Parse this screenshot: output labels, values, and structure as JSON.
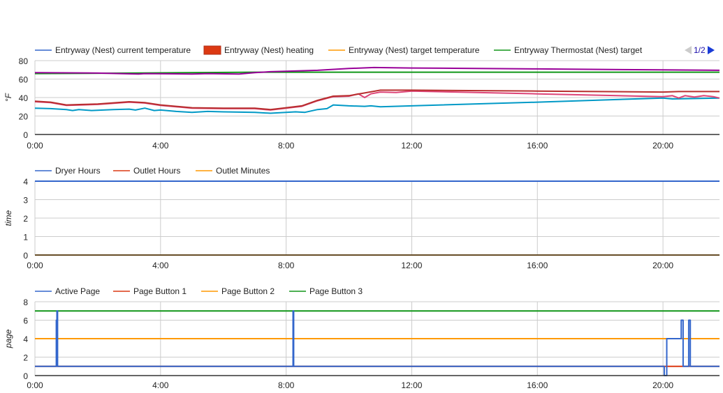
{
  "pager": {
    "label": "1/2"
  },
  "chart_data": [
    {
      "type": "line",
      "ylabel": "°F",
      "ylim": [
        0,
        80
      ],
      "yticks": [
        "0",
        "20",
        "40",
        "60",
        "80"
      ],
      "yvals": [
        0,
        20,
        40,
        60,
        80
      ],
      "xlim": [
        0,
        21.8
      ],
      "xticks": [
        "0:00",
        "4:00",
        "8:00",
        "12:00",
        "16:00",
        "20:00"
      ],
      "xvals": [
        0,
        4,
        8,
        12,
        16,
        20
      ],
      "legend": [
        {
          "label": "Entryway (Nest) current temperature",
          "color": "#3366cc",
          "kind": "line"
        },
        {
          "label": "Entryway (Nest) heating",
          "color": "#dc3912",
          "kind": "box"
        },
        {
          "label": "Entryway (Nest) target temperature",
          "color": "#ff9900",
          "kind": "line"
        },
        {
          "label": "Entryway Thermostat (Nest) target",
          "color": "#109618",
          "kind": "line"
        }
      ],
      "series": [
        {
          "name": "Entryway Thermostat (Nest) target",
          "color": "#109618",
          "points": [
            [
              0,
              66
            ],
            [
              3,
              66.5
            ],
            [
              7,
              67.5
            ],
            [
              21.8,
              67.5
            ]
          ]
        },
        {
          "name": "Entryway (Nest) current temperature",
          "color": "#990099",
          "points": [
            [
              0,
              67
            ],
            [
              2,
              66.5
            ],
            [
              3.3,
              65.5
            ],
            [
              3.5,
              66
            ],
            [
              5,
              65.5
            ],
            [
              5.5,
              66
            ],
            [
              6.5,
              65.5
            ],
            [
              7,
              67
            ],
            [
              7.5,
              68
            ],
            [
              8,
              68.5
            ],
            [
              9,
              69.5
            ],
            [
              10,
              71.5
            ],
            [
              10.8,
              72.5
            ],
            [
              12,
              72
            ],
            [
              16,
              71
            ],
            [
              20,
              70
            ],
            [
              21.8,
              69.5
            ]
          ]
        },
        {
          "name": "Entryway (Nest) current temperature",
          "color": "#0099c6",
          "points": [
            [
              0,
              28.5
            ],
            [
              0.5,
              28
            ],
            [
              1,
              27
            ],
            [
              1.2,
              26
            ],
            [
              1.4,
              27
            ],
            [
              1.8,
              26
            ],
            [
              2.5,
              27
            ],
            [
              3,
              27.5
            ],
            [
              3.2,
              26.5
            ],
            [
              3.5,
              28.5
            ],
            [
              3.8,
              26
            ],
            [
              4,
              26.5
            ],
            [
              4.5,
              25
            ],
            [
              5,
              24
            ],
            [
              5.5,
              25
            ],
            [
              6,
              24.5
            ],
            [
              7,
              24
            ],
            [
              7.5,
              23
            ],
            [
              8,
              24
            ],
            [
              8.3,
              24.5
            ],
            [
              8.6,
              24
            ],
            [
              9,
              27
            ],
            [
              9.3,
              28
            ],
            [
              9.5,
              32
            ],
            [
              10,
              31
            ],
            [
              10.5,
              30.5
            ],
            [
              10.7,
              31
            ],
            [
              11,
              30
            ],
            [
              12,
              31
            ],
            [
              16,
              35
            ],
            [
              20,
              39.5
            ],
            [
              20.3,
              38.5
            ],
            [
              21.8,
              39.5
            ]
          ]
        },
        {
          "name": "Entryway (Nest) target temperature",
          "color": "#dd4477",
          "points": [
            [
              0,
              35.5
            ],
            [
              0.5,
              34.5
            ],
            [
              1,
              31.5
            ],
            [
              1.5,
              32
            ],
            [
              2,
              32.5
            ],
            [
              3,
              35
            ],
            [
              3.5,
              34
            ],
            [
              4,
              31.5
            ],
            [
              5,
              28.5
            ],
            [
              6,
              28
            ],
            [
              7,
              28
            ],
            [
              7.5,
              26.5
            ],
            [
              8,
              28.5
            ],
            [
              8.5,
              30.5
            ],
            [
              9,
              36.5
            ],
            [
              9.5,
              41
            ],
            [
              10,
              41.5
            ],
            [
              10.3,
              44
            ],
            [
              10.5,
              40
            ],
            [
              10.7,
              44
            ],
            [
              11,
              46
            ],
            [
              11.5,
              45.5
            ],
            [
              12,
              47
            ],
            [
              16,
              44
            ],
            [
              20,
              41
            ],
            [
              20.3,
              42
            ],
            [
              20.5,
              39.5
            ],
            [
              20.7,
              42
            ],
            [
              21,
              40.5
            ],
            [
              21.3,
              42
            ],
            [
              21.6,
              41
            ],
            [
              21.8,
              39.5
            ]
          ]
        },
        {
          "name": "Entryway (Nest) heating",
          "color": "#b82e2e",
          "points": [
            [
              0,
              36
            ],
            [
              0.5,
              35
            ],
            [
              1,
              32
            ],
            [
              1.5,
              32.5
            ],
            [
              2,
              33
            ],
            [
              3,
              35.5
            ],
            [
              3.5,
              34.5
            ],
            [
              4,
              32
            ],
            [
              5,
              29
            ],
            [
              6,
              28.5
            ],
            [
              7,
              28.5
            ],
            [
              7.5,
              27
            ],
            [
              8,
              29
            ],
            [
              8.5,
              31
            ],
            [
              9,
              37
            ],
            [
              9.5,
              41.5
            ],
            [
              10,
              42
            ],
            [
              10.5,
              45
            ],
            [
              11,
              48
            ],
            [
              12,
              48
            ],
            [
              16,
              47
            ],
            [
              20,
              46
            ],
            [
              20.5,
              46.5
            ],
            [
              21.8,
              46.5
            ]
          ]
        }
      ]
    },
    {
      "type": "line",
      "ylabel": "time",
      "ylim": [
        0,
        4
      ],
      "yticks": [
        "0",
        "1",
        "2",
        "3",
        "4"
      ],
      "yvals": [
        0,
        1,
        2,
        3,
        4
      ],
      "xlim": [
        0,
        21.8
      ],
      "xticks": [
        "0:00",
        "4:00",
        "8:00",
        "12:00",
        "16:00",
        "20:00"
      ],
      "xvals": [
        0,
        4,
        8,
        12,
        16,
        20
      ],
      "legend": [
        {
          "label": "Dryer Hours",
          "color": "#3366cc",
          "kind": "line"
        },
        {
          "label": "Outlet Hours",
          "color": "#dc3912",
          "kind": "line"
        },
        {
          "label": "Outlet Minutes",
          "color": "#ff9900",
          "kind": "line"
        }
      ],
      "series": [
        {
          "name": "Outlet Hours",
          "color": "#dc3912",
          "points": [
            [
              0,
              0
            ],
            [
              21.8,
              0
            ]
          ]
        },
        {
          "name": "Outlet Minutes",
          "color": "#ff9900",
          "points": [
            [
              0,
              0
            ],
            [
              21.8,
              0
            ]
          ]
        },
        {
          "name": "Dryer Hours",
          "color": "#3366cc",
          "points": [
            [
              0,
              4
            ],
            [
              21.8,
              4
            ]
          ]
        }
      ]
    },
    {
      "type": "line",
      "ylabel": "page",
      "ylim": [
        0,
        8
      ],
      "yticks": [
        "0",
        "2",
        "4",
        "6",
        "8"
      ],
      "yvals": [
        0,
        2,
        4,
        6,
        8
      ],
      "xlim": [
        0,
        21.8
      ],
      "xticks": [
        "0:00",
        "4:00",
        "8:00",
        "12:00",
        "16:00",
        "20:00"
      ],
      "xvals": [
        0,
        4,
        8,
        12,
        16,
        20
      ],
      "legend": [
        {
          "label": "Active Page",
          "color": "#3366cc",
          "kind": "line"
        },
        {
          "label": "Page Button 1",
          "color": "#dc3912",
          "kind": "line"
        },
        {
          "label": "Page Button 2",
          "color": "#ff9900",
          "kind": "line"
        },
        {
          "label": "Page Button 3",
          "color": "#109618",
          "kind": "line"
        }
      ],
      "series": [
        {
          "name": "Page Button 1",
          "color": "#dc3912",
          "points": [
            [
              0,
              1
            ],
            [
              21.8,
              1
            ]
          ]
        },
        {
          "name": "Page Button 2",
          "color": "#ff9900",
          "points": [
            [
              0,
              4
            ],
            [
              21.8,
              4
            ]
          ]
        },
        {
          "name": "Page Button 3",
          "color": "#109618",
          "points": [
            [
              0,
              7
            ],
            [
              21.8,
              7
            ]
          ]
        },
        {
          "name": "Active Page",
          "color": "#3366cc",
          "points": [
            [
              0,
              1
            ],
            [
              0.68,
              1
            ],
            [
              0.68,
              6
            ],
            [
              0.7,
              6
            ],
            [
              0.7,
              7
            ],
            [
              0.72,
              7
            ],
            [
              0.72,
              1
            ],
            [
              8.22,
              1
            ],
            [
              8.22,
              7
            ],
            [
              8.24,
              7
            ],
            [
              8.24,
              1
            ],
            [
              20.04,
              1
            ],
            [
              20.04,
              0
            ],
            [
              20.12,
              0
            ],
            [
              20.12,
              4
            ],
            [
              20.58,
              4
            ],
            [
              20.58,
              6
            ],
            [
              20.64,
              6
            ],
            [
              20.64,
              1
            ],
            [
              20.82,
              1
            ],
            [
              20.82,
              6
            ],
            [
              20.87,
              6
            ],
            [
              20.87,
              1
            ],
            [
              21.8,
              1
            ]
          ]
        }
      ]
    }
  ]
}
